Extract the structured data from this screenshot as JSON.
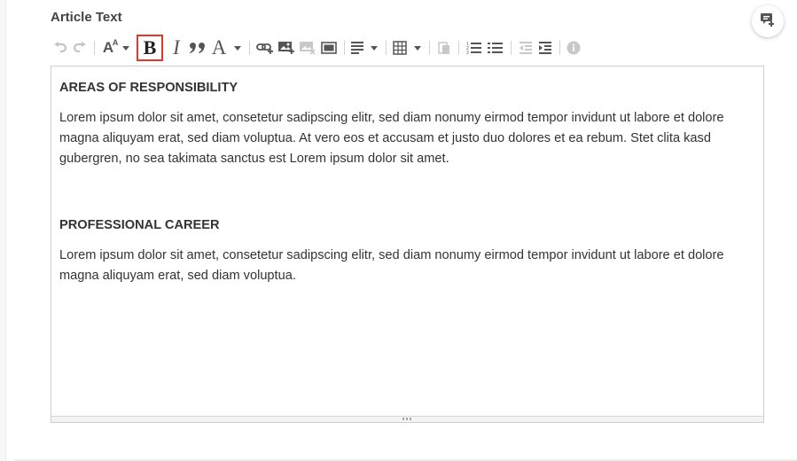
{
  "field": {
    "label": "Article Text"
  },
  "toolbar": {
    "bold_glyph": "B",
    "italic_glyph": "I",
    "quote_glyph": "”",
    "font_color_glyph": "A",
    "font_size_glyph": "A",
    "highlight_color": "#e3372b"
  },
  "editor": {
    "heading1": "AREAS OF RESPONSIBILITY",
    "para1": "Lorem ipsum dolor sit amet, consetetur sadipscing elitr, sed diam nonumy eirmod tempor invidunt ut labore et dolore magna aliquyam erat, sed diam voluptua. At vero eos et accusam et justo duo dolores et ea rebum. Stet clita kasd gubergren, no sea takimata sanctus est Lorem ipsum dolor sit amet.",
    "heading2": "PROFESSIONAL CAREER",
    "para2": "Lorem ipsum dolor sit amet, consetetur sadipscing elitr, sed diam nonumy eirmod tempor invidunt ut labore et dolore magna aliquyam erat, sed diam voluptua."
  },
  "icons": [
    "undo-icon",
    "redo-icon",
    "font-size-icon",
    "bold-icon",
    "italic-icon",
    "blockquote-icon",
    "font-color-icon",
    "link-icon",
    "image-icon",
    "remove-image-icon",
    "embed-icon",
    "align-icon",
    "table-icon",
    "paste-icon",
    "numbered-list-icon",
    "bulleted-list-icon",
    "outdent-icon",
    "indent-icon",
    "info-icon",
    "add-comment-icon"
  ]
}
